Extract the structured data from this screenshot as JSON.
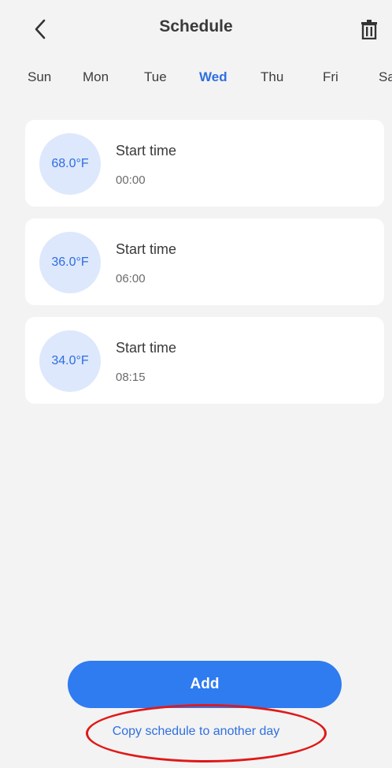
{
  "header": {
    "title": "Schedule",
    "back_icon": "chevron-left-icon",
    "delete_icon": "trash-icon"
  },
  "days": [
    {
      "label": "Sun",
      "active": false
    },
    {
      "label": "Mon",
      "active": false
    },
    {
      "label": "Tue",
      "active": false
    },
    {
      "label": "Wed",
      "active": true
    },
    {
      "label": "Thu",
      "active": false
    },
    {
      "label": "Fri",
      "active": false
    },
    {
      "label": "Sat",
      "active": false
    }
  ],
  "schedules": [
    {
      "temperature": "68.0°F",
      "label": "Start time",
      "time": "00:00"
    },
    {
      "temperature": "36.0°F",
      "label": "Start time",
      "time": "06:00"
    },
    {
      "temperature": "34.0°F",
      "label": "Start time",
      "time": "08:15"
    }
  ],
  "footer": {
    "add_label": "Add",
    "copy_label": "Copy schedule to another day"
  },
  "colors": {
    "accent": "#2f7bf0",
    "active_day": "#2f6fe0",
    "temp_circle_bg": "#dde8fc",
    "highlight": "#e01818"
  }
}
